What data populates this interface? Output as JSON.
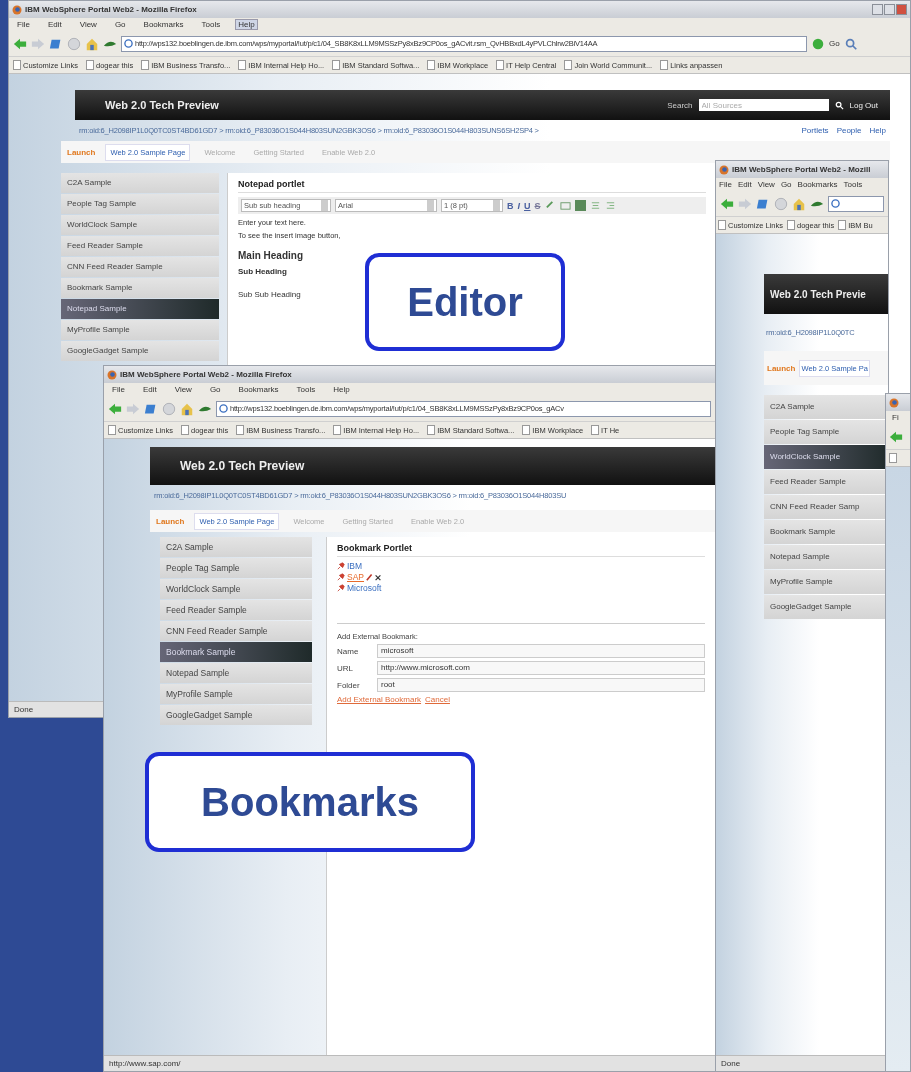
{
  "windows": [
    {
      "kind": "full",
      "title": "IBM WebSphere Portal Web2 - Mozilla Firefox",
      "menu": [
        {
          "label": "File",
          "selected": false
        },
        {
          "label": "Edit",
          "selected": false
        },
        {
          "label": "View",
          "selected": false
        },
        {
          "label": "Go",
          "selected": false
        },
        {
          "label": "Bookmarks",
          "selected": false
        },
        {
          "label": "Tools",
          "selected": false
        },
        {
          "label": "Help",
          "selected": true
        }
      ],
      "url": "http://wps132.boeblingen.de.ibm.com/wps/myportal/!ut/p/c1/04_SB8K8xLLM9MSSzPy8xBz9CP0os_gACvit.rsm_QvHBBxdL4yPVLChlrw2BiV14AA",
      "go": "Go",
      "bookmarks": [
        "Customize Links",
        "dogear this",
        "IBM Business Transfo...",
        "IBM Internal Help Ho...",
        "IBM Standard Softwa...",
        "IBM Workplace",
        "IT Help Central",
        "Join World Communit...",
        "Links anpassen"
      ],
      "banner": "Web 2.0 Tech Preview",
      "search": {
        "label": "Search",
        "placeholder": "All Sources",
        "logout": "Log Out"
      },
      "breadcrumb": "rm:oid:6_H2098IP1L0Q0TC0ST4BD61GD7 > rm:oid:6_P83036O1S044H803SUN2GBK3OS6 > rm:oid:6_P83036O1S044H803SUNS6SH2SP4 >",
      "header_links": [
        "Portlets",
        "People",
        "Help"
      ],
      "launch": "Launch",
      "tabs": [
        {
          "label": "Web 2.0 Sample Page",
          "selected": true
        },
        {
          "label": "Welcome",
          "selected": false
        },
        {
          "label": "Getting Started",
          "selected": false
        },
        {
          "label": "Enable Web 2.0",
          "selected": false
        }
      ],
      "sidebar": [
        {
          "label": "C2A Sample",
          "selected": false
        },
        {
          "label": "People Tag Sample",
          "selected": false
        },
        {
          "label": "WorldClock Sample",
          "selected": false
        },
        {
          "label": "Feed Reader Sample",
          "selected": false
        },
        {
          "label": "CNN Feed Reader Sample",
          "selected": false
        },
        {
          "label": "Bookmark Sample",
          "selected": false
        },
        {
          "label": "Notepad Sample",
          "selected": true
        },
        {
          "label": "MyProfile Sample",
          "selected": false
        },
        {
          "label": "GoogleGadget Sample",
          "selected": false
        }
      ],
      "portlet": {
        "kind": "notepad",
        "title": "Notepad portlet",
        "selects": [
          "Sub sub heading",
          "Arial",
          "1 (8 pt)"
        ],
        "format_buttons": [
          "B",
          "I",
          "U",
          "S"
        ],
        "lines": [
          "Enter your text here.",
          "To see the insert image button,"
        ],
        "headings": [
          "Main Heading",
          "Sub Heading",
          "Sub Sub Heading"
        ]
      },
      "status": "Done"
    },
    {
      "kind": "full",
      "title": "IBM WebSphere Portal Web2 - Mozilla Firefox",
      "menu": [
        {
          "label": "File",
          "selected": false
        },
        {
          "label": "Edit",
          "selected": false
        },
        {
          "label": "View",
          "selected": false
        },
        {
          "label": "Go",
          "selected": false
        },
        {
          "label": "Bookmarks",
          "selected": false
        },
        {
          "label": "Tools",
          "selected": false
        },
        {
          "label": "Help",
          "selected": false
        }
      ],
      "url": "http://wps132.boeblingen.de.ibm.com/wps/myportal/!ut/p/c1/04_SB8K8xLLM9MSSzPy8xBz9CP0os_gACv",
      "bookmarks": [
        "Customize Links",
        "dogear this",
        "IBM Business Transfo...",
        "IBM Internal Help Ho...",
        "IBM Standard Softwa...",
        "IBM Workplace",
        "IT He"
      ],
      "banner": "Web 2.0 Tech Preview",
      "breadcrumb": "rm:oid:6_H2098IP1L0Q0TC0ST4BD61GD7 > rm:oid:6_P83036O1S044H803SUN2GBK3OS6 > rm:oid:6_P83036O1S044H803SU",
      "launch": "Launch",
      "tabs": [
        {
          "label": "Web 2.0 Sample Page",
          "selected": true
        },
        {
          "label": "Welcome",
          "selected": false
        },
        {
          "label": "Getting Started",
          "selected": false
        },
        {
          "label": "Enable Web 2.0",
          "selected": false
        }
      ],
      "sidebar": [
        {
          "label": "C2A Sample",
          "selected": false
        },
        {
          "label": "People Tag Sample",
          "selected": false
        },
        {
          "label": "WorldClock Sample",
          "selected": false
        },
        {
          "label": "Feed Reader Sample",
          "selected": false
        },
        {
          "label": "CNN Feed Reader Sample",
          "selected": false
        },
        {
          "label": "Bookmark Sample",
          "selected": true
        },
        {
          "label": "Notepad Sample",
          "selected": false
        },
        {
          "label": "MyProfile Sample",
          "selected": false
        },
        {
          "label": "GoogleGadget Sample",
          "selected": false
        }
      ],
      "portlet": {
        "kind": "bookmark",
        "title": "Bookmark Portlet",
        "links": [
          {
            "label": "IBM",
            "selected": false
          },
          {
            "label": "SAP",
            "selected": true
          },
          {
            "label": "Microsoft",
            "selected": false
          }
        ],
        "form_title": "Add External Bookmark:",
        "fields": [
          {
            "label": "Name",
            "value": "microsoft"
          },
          {
            "label": "URL",
            "value": "http://www.microsoft.com"
          },
          {
            "label": "Folder",
            "value": "root"
          }
        ],
        "actions": [
          "Add External Bookmark",
          "Cancel"
        ]
      },
      "status": "http://www.sap.com/"
    },
    {
      "kind": "full",
      "title": "IBM WebSphere Portal Web2 - Mozill",
      "menu": [
        {
          "label": "File",
          "selected": false
        },
        {
          "label": "Edit",
          "selected": false
        },
        {
          "label": "View",
          "selected": false
        },
        {
          "label": "Go",
          "selected": false
        },
        {
          "label": "Bookmarks",
          "selected": false
        },
        {
          "label": "Tools",
          "selected": false
        }
      ],
      "bookmarks": [
        "Customize Links",
        "dogear this",
        "IBM Bu"
      ],
      "banner": "Web 2.0 Tech Previe",
      "breadcrumb": "rm:oid:6_H2098IP1L0Q0TC",
      "launch": "Launch",
      "tabs": [
        {
          "label": "Web 2.0 Sample Pa",
          "selected": true
        }
      ],
      "sidebar": [
        {
          "label": "C2A Sample",
          "selected": false
        },
        {
          "label": "People Tag Sample",
          "selected": false
        },
        {
          "label": "WorldClock Sample",
          "selected": true
        },
        {
          "label": "Feed Reader Sample",
          "selected": false
        },
        {
          "label": "CNN Feed Reader Samp",
          "selected": false
        },
        {
          "label": "Bookmark Sample",
          "selected": false
        },
        {
          "label": "Notepad Sample",
          "selected": false
        },
        {
          "label": "MyProfile Sample",
          "selected": false
        },
        {
          "label": "GoogleGadget Sample",
          "selected": false
        }
      ],
      "status": "Done"
    },
    {
      "kind": "fragment",
      "menu": [
        {
          "label": "Fi",
          "selected": false
        }
      ]
    }
  ],
  "callouts": [
    {
      "text": "Editor"
    },
    {
      "text": "Bookmarks"
    }
  ]
}
